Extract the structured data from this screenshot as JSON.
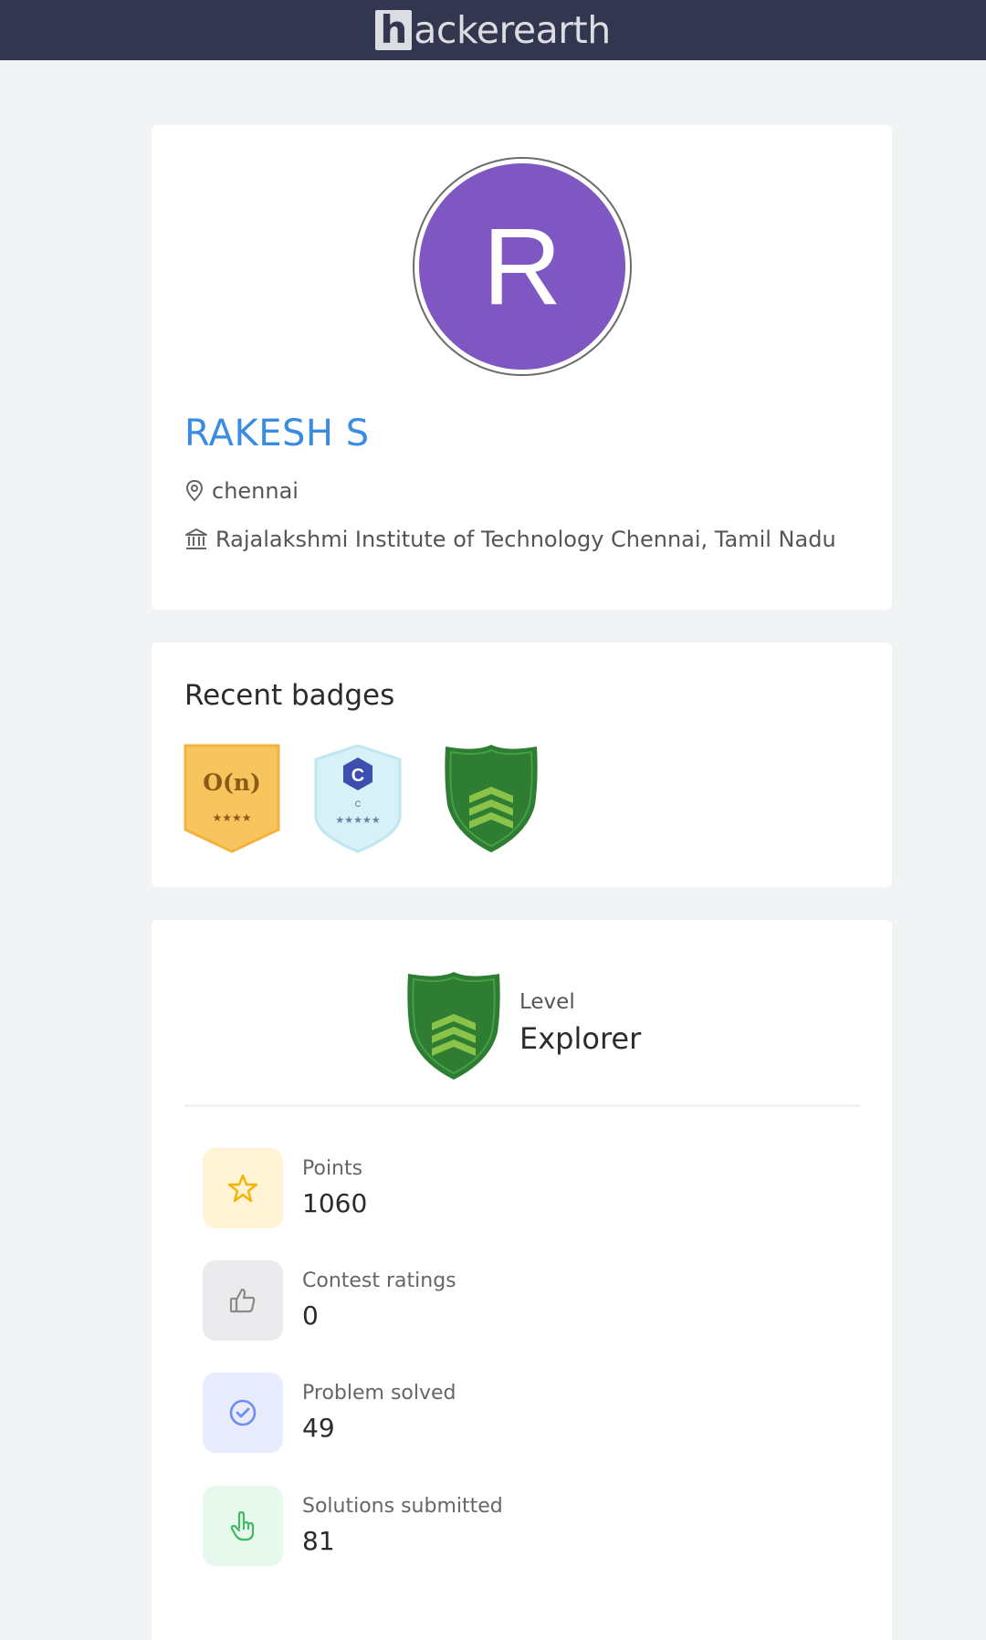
{
  "header": {
    "logo_letter": "h",
    "logo_text": "ackerearth"
  },
  "profile": {
    "avatar_initial": "R",
    "avatar_color": "#7e57c2",
    "name": "RAKESH S",
    "location": "chennai",
    "institution": "Rajalakshmi Institute of Technology Chennai, Tamil Nadu"
  },
  "badges": {
    "title": "Recent badges",
    "items": [
      {
        "icon": "complexity-badge-icon",
        "text": "O(n)",
        "stars": "★★★★"
      },
      {
        "icon": "c-language-badge-icon",
        "letter": "C",
        "sub": "C",
        "stars": "★★★★★"
      },
      {
        "icon": "explorer-shield-icon"
      }
    ]
  },
  "level": {
    "label": "Level",
    "name": "Explorer"
  },
  "stats": [
    {
      "icon": "star-icon",
      "label": "Points",
      "value": "1060",
      "color": "#fff4d6"
    },
    {
      "icon": "thumbs-up-icon",
      "label": "Contest ratings",
      "value": "0",
      "color": "#ebebed"
    },
    {
      "icon": "check-circle-icon",
      "label": "Problem solved",
      "value": "49",
      "color": "#e8ecfd"
    },
    {
      "icon": "pointer-hand-icon",
      "label": "Solutions submitted",
      "value": "81",
      "color": "#e7f8ec"
    }
  ]
}
